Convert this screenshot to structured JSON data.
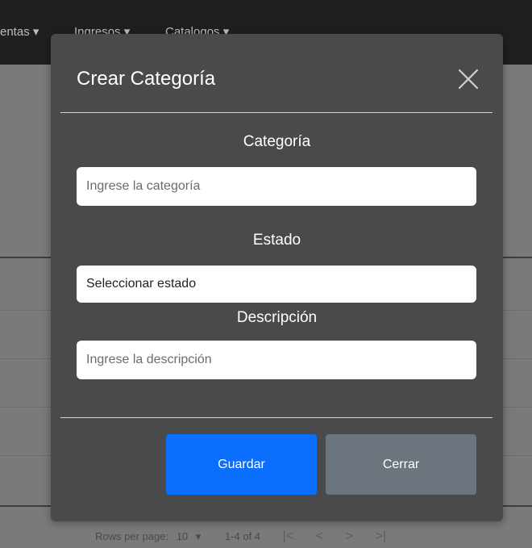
{
  "background": {
    "nav": [
      "entas ▾",
      "Ingresos ▾",
      "Catalogos ▾"
    ],
    "pagination": {
      "rows_per_page_label": "Rows per page:",
      "rows_per_page_value": "10",
      "range": "1-4 of 4"
    }
  },
  "modal": {
    "title": "Crear Categoría",
    "fields": {
      "categoria_label": "Categoría",
      "categoria_placeholder": "Ingrese la categoría",
      "estado_label": "Estado",
      "estado_value": "Seleccionar estado",
      "descripcion_label": "Descripción",
      "descripcion_placeholder": "Ingrese la descripción"
    },
    "buttons": {
      "save": "Guardar",
      "close": "Cerrar"
    }
  },
  "colors": {
    "modal_bg": "#4a4a4a",
    "primary": "#0b6efd",
    "secondary": "#6c757d"
  },
  "icons": [
    "close-icon",
    "chevron-down-icon",
    "first-page-icon",
    "prev-page-icon",
    "next-page-icon",
    "last-page-icon"
  ]
}
